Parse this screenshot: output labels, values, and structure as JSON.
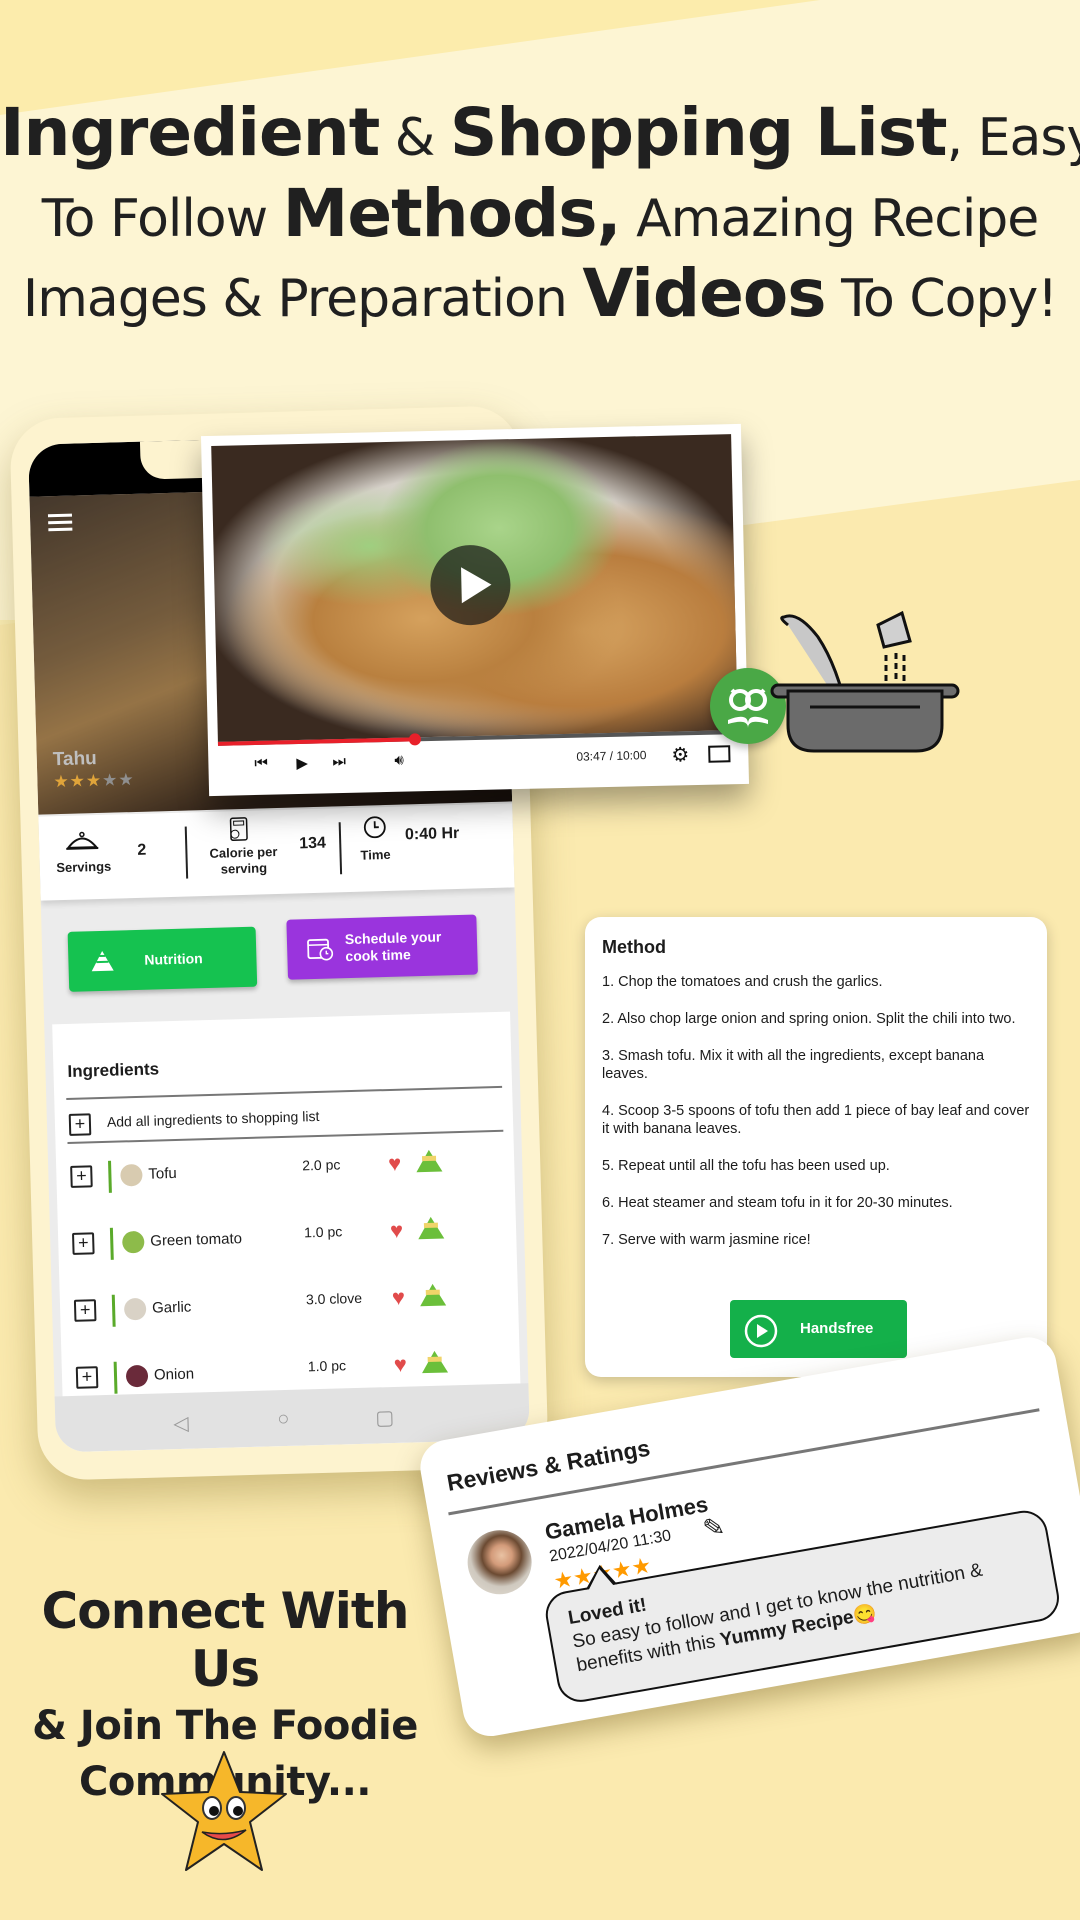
{
  "headline": {
    "line1": [
      {
        "text": "Ingredient",
        "style": "big"
      },
      {
        "text": " & ",
        "style": "mid"
      },
      {
        "text": "Shopping List",
        "style": "big"
      },
      {
        "text": ", Easy",
        "style": "mid"
      }
    ],
    "line2": [
      {
        "text": "To Follow ",
        "style": "mid"
      },
      {
        "text": "Methods,",
        "style": "big"
      },
      {
        "text": " Amazing Recipe",
        "style": "mid"
      }
    ],
    "line3": [
      {
        "text": "Images & Preparation ",
        "style": "mid"
      },
      {
        "text": "Videos",
        "style": "big"
      },
      {
        "text": " To Copy!",
        "style": "mid"
      }
    ]
  },
  "recipe": {
    "title": "Tahu",
    "rating": 3,
    "rating_max": 5
  },
  "stats": {
    "servings_label": "Servings",
    "servings_value": "2",
    "calorie_label": "Calorie per serving",
    "calorie_value": "134",
    "time_label": "Time",
    "time_value": "0:40 Hr"
  },
  "buttons": {
    "nutrition": "Nutrition",
    "schedule": "Schedule your cook time"
  },
  "ingredients": {
    "title": "Ingredients",
    "add_all": "Add all ingredients to shopping list",
    "items": [
      {
        "name": "Tofu",
        "qty": "2.0 pc",
        "thumb_color": "#d8cbb0"
      },
      {
        "name": "Green tomato",
        "qty": "1.0 pc",
        "thumb_color": "#8dbb4a"
      },
      {
        "name": "Garlic",
        "qty": "3.0 clove",
        "thumb_color": "#d9d2c6"
      },
      {
        "name": "Onion",
        "qty": "1.0 pc",
        "thumb_color": "#6a2a3a"
      }
    ]
  },
  "video": {
    "time": "03:47 / 10:00",
    "progress": 0.378
  },
  "method": {
    "title": "Method",
    "steps": [
      "1. Chop the tomatoes and crush the garlics.",
      "2. Also chop large onion and spring onion. Split the chili into two.",
      "3. Smash tofu. Mix it with all the ingredients, except banana leaves.",
      "4. Scoop 3-5 spoons of tofu then add 1 piece of bay leaf and cover it with banana leaves.",
      "5. Repeat until all the tofu has been used up.",
      "6. Heat steamer and steam tofu in it for 20-30 minutes.",
      "7. Serve with warm jasmine rice!"
    ],
    "handsfree": "Handsfree"
  },
  "reviews": {
    "title": "Reviews & Ratings",
    "items": [
      {
        "name": "Gamela Holmes",
        "date": "2022/04/20 11:30",
        "stars": 5,
        "headline": "Loved it!",
        "body": "So easy to follow and I get to know the nutrition & benefits with this ",
        "emphasis": "Yummy Recipe",
        "emoji": "😋"
      }
    ]
  },
  "connect": {
    "line1": "Connect With Us",
    "line2": "& Join The Foodie",
    "line3": "Community..."
  },
  "colors": {
    "green": "#15c250",
    "purple": "#9a34dd",
    "progress_red": "#e8202a",
    "star_orange": "#ff9a00"
  }
}
